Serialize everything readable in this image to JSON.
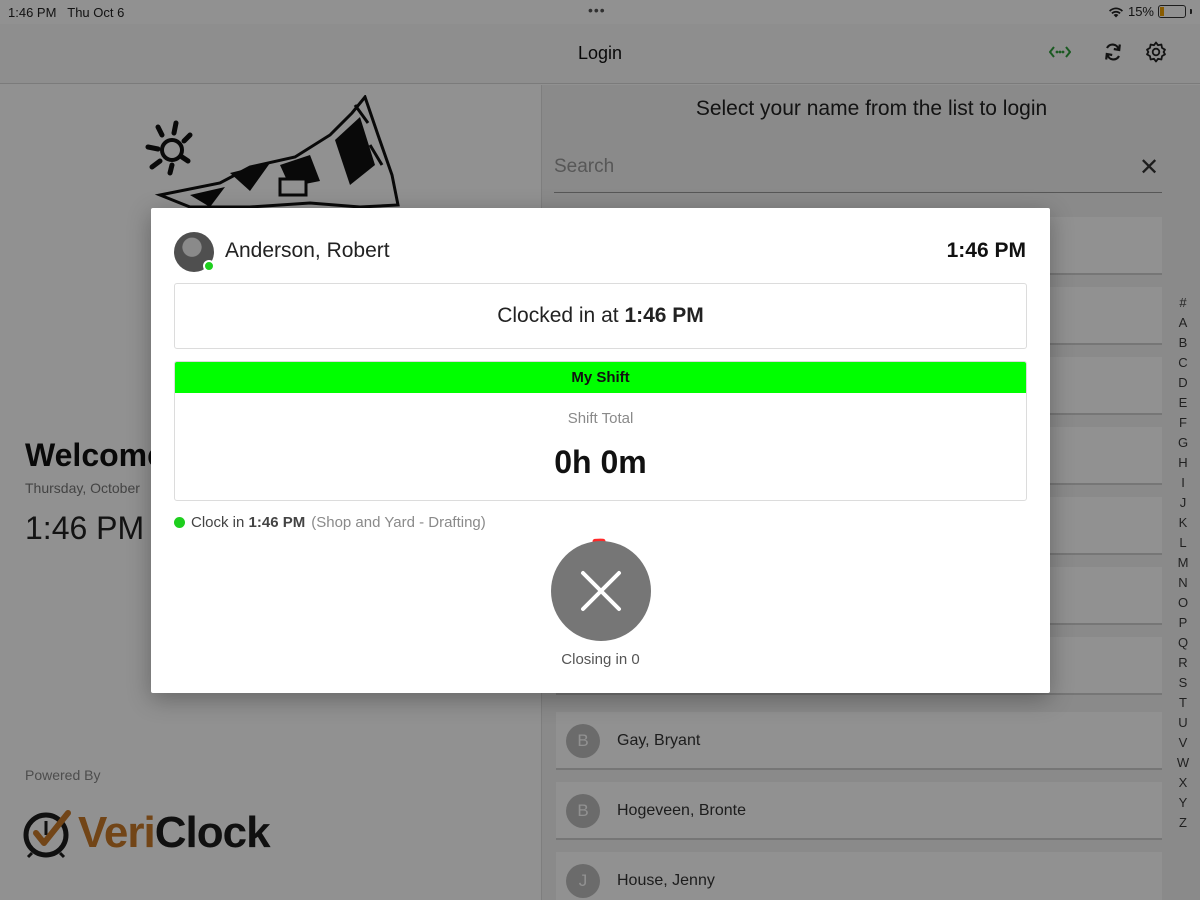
{
  "status_bar": {
    "time": "1:46 PM",
    "date": "Thu Oct 6",
    "battery": "15%",
    "battery_level": 0.15
  },
  "nav": {
    "title": "Login",
    "icons": [
      "network-status-icon",
      "refresh-icon",
      "settings-icon"
    ],
    "network_color": "#2e9e3a"
  },
  "left": {
    "welcome": "Welcome",
    "date": "Thursday, October",
    "time": "1:46 PM",
    "powered_by": "Powered By",
    "brand_part_a": "Veri",
    "brand_part_b": "Clock"
  },
  "right": {
    "prompt": "Select your name from the list to login",
    "search": {
      "placeholder": "Search",
      "value": ""
    },
    "employees": [
      {
        "initial": "B",
        "name": "Gay, Bryant"
      },
      {
        "initial": "B",
        "name": "Hogeveen, Bronte"
      },
      {
        "initial": "J",
        "name": "House, Jenny"
      }
    ],
    "alpha_index": [
      "#",
      "A",
      "B",
      "C",
      "D",
      "E",
      "F",
      "G",
      "H",
      "I",
      "J",
      "K",
      "L",
      "M",
      "N",
      "O",
      "P",
      "Q",
      "R",
      "S",
      "T",
      "U",
      "V",
      "W",
      "X",
      "Y",
      "Z"
    ]
  },
  "modal": {
    "user_name": "Anderson, Robert",
    "time": "1:46 PM",
    "clocked_prefix": "Clocked in at",
    "clocked_time": "1:46 PM",
    "shift_header": "My Shift",
    "shift_label": "Shift Total",
    "shift_total": "0h 0m",
    "event_prefix": "Clock in",
    "event_time": "1:46 PM",
    "event_location": "(Shop and Yard - Drafting)",
    "closing_text": "Closing in 0",
    "accent_green": "#00ff00",
    "countdown_color": "#ff2a2a"
  }
}
